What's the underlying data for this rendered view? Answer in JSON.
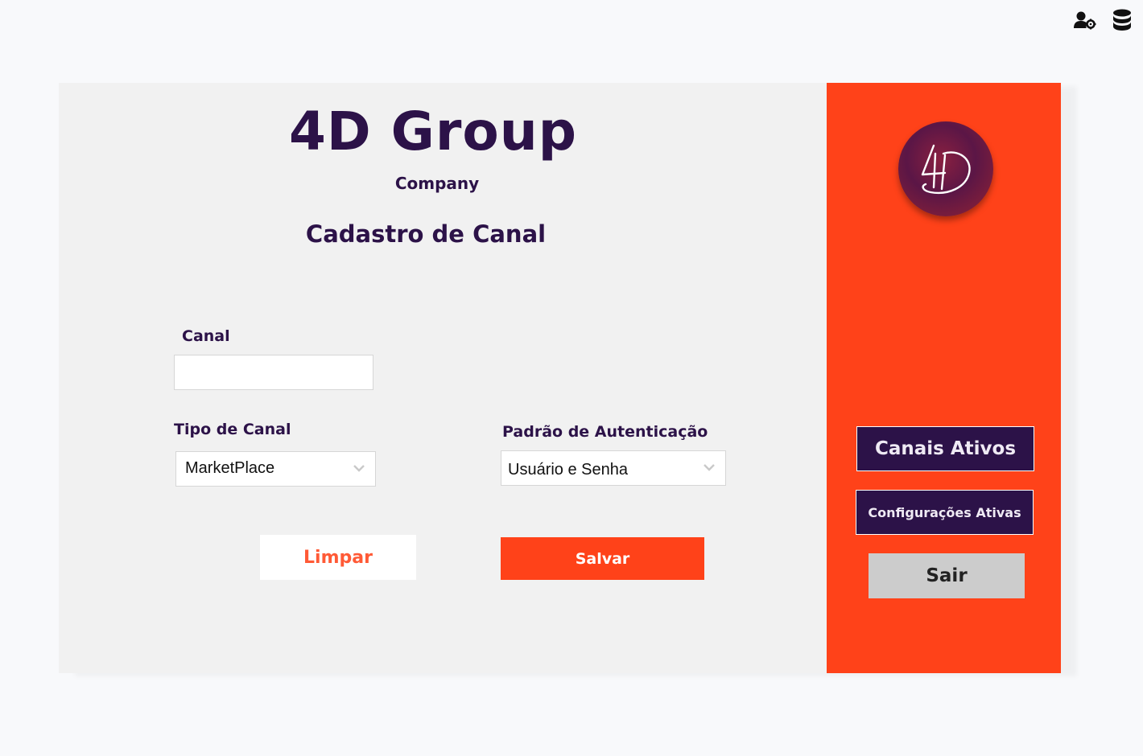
{
  "header": {
    "user_settings_icon": "user-gear-icon",
    "database_icon": "database-icon"
  },
  "brand": {
    "title": "4D Group",
    "subtitle": "Company",
    "logo_text": "4D"
  },
  "page": {
    "title": "Cadastro de Canal"
  },
  "form": {
    "canal": {
      "label": "Canal",
      "value": ""
    },
    "tipo_canal": {
      "label": "Tipo de Canal",
      "selected": "MarketPlace",
      "icon": "chevron-down-icon"
    },
    "padrao_autenticacao": {
      "label": "Padrão de Autenticação",
      "selected": "Usuário e Senha",
      "icon": "chevron-down-icon"
    },
    "clear_label": "Limpar",
    "save_label": "Salvar"
  },
  "sidebar": {
    "active_channels_label": "Canais Ativos",
    "active_configs_label": "Configurações Ativas",
    "logout_label": "Sair"
  },
  "colors": {
    "brand_purple": "#2c1248",
    "accent_orange": "#ff4219",
    "panel_bg": "#f1f1f1",
    "page_bg": "#f8f9fb",
    "logout_gray": "#cccccc"
  }
}
